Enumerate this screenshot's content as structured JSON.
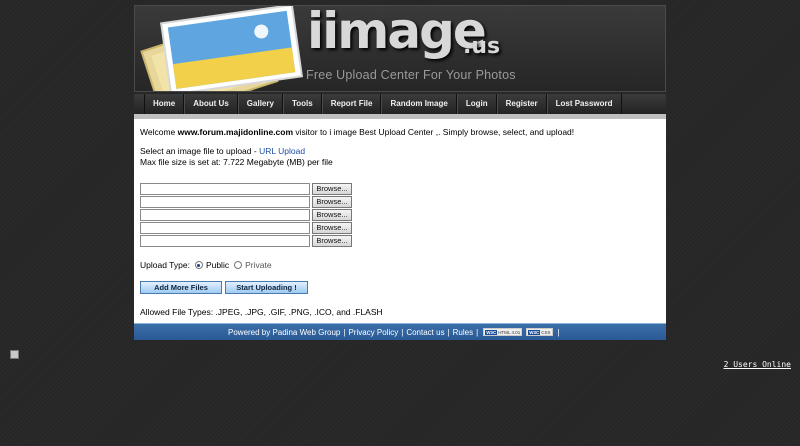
{
  "site": {
    "logo_main": "iimage",
    "logo_ext": ".us",
    "tagline": "Free Upload Center For Your Photos"
  },
  "nav": {
    "items": [
      {
        "label": "Home"
      },
      {
        "label": "About Us"
      },
      {
        "label": "Gallery"
      },
      {
        "label": "Tools"
      },
      {
        "label": "Report File"
      },
      {
        "label": "Random Image"
      },
      {
        "label": "Login"
      },
      {
        "label": "Register"
      },
      {
        "label": "Lost Password"
      }
    ]
  },
  "content": {
    "welcome_prefix": "Welcome ",
    "welcome_site": "www.forum.majidonline.com",
    "welcome_suffix": " visitor to i image Best Upload Center ,. Simply browse, select, and upload!",
    "select_prefix": "Select an image file to upload - ",
    "url_upload_link": "URL Upload",
    "max_size": "Max file size is set at: 7.722 Megabyte (MB) per file",
    "browse_label": "Browse...",
    "upload_type_label": "Upload Type:",
    "public_label": "Public",
    "private_label": "Private",
    "selected_upload_type": "Public",
    "add_more_label": "Add More Files",
    "start_upload_label": "Start Uploading !",
    "allowed_types": "Allowed File Types: .JPEG, .JPG, .GIF, .PNG, .ICO, and .FLASH"
  },
  "footer": {
    "powered_by": "Powered by Padina Web Group",
    "privacy": "Privacy Policy",
    "contact": "Contact us",
    "rules": "Rules",
    "separator": "|",
    "badge_w3c": "W3C",
    "badge_html": "HTML 4.01",
    "badge_css": "CSS"
  },
  "status": {
    "users_online": "2 Users Online"
  },
  "colors": {
    "accent_blue": "#2a5a96",
    "link": "#1f4ea8",
    "background": "#262626"
  }
}
